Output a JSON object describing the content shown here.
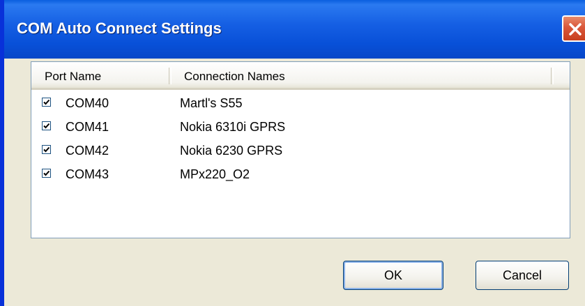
{
  "window": {
    "title": "COM Auto Connect Settings"
  },
  "list": {
    "columns": [
      "Port Name",
      "Connection Names"
    ],
    "rows": [
      {
        "checked": true,
        "port": "COM40",
        "connection": "Martl's S55"
      },
      {
        "checked": true,
        "port": "COM41",
        "connection": "Nokia 6310i GPRS"
      },
      {
        "checked": true,
        "port": "COM42",
        "connection": "Nokia 6230 GPRS"
      },
      {
        "checked": true,
        "port": "COM43",
        "connection": "MPx220_O2"
      }
    ]
  },
  "buttons": {
    "ok_label": "OK",
    "cancel_label": "Cancel"
  },
  "icons": {
    "close": "close-icon",
    "checkbox": "checkmark-icon"
  },
  "colors": {
    "titlebar": "#0a5fdf",
    "close_button": "#d9573a",
    "dialog_background": "#ece9d8"
  }
}
